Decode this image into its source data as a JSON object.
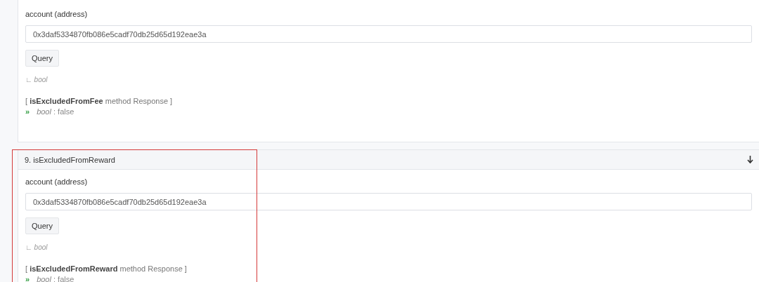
{
  "sections": [
    {
      "param_label": "account (address)",
      "value": "0x3daf5334870fb086e5cadf70db25d65d192eae3a",
      "button": "Query",
      "return_mark": "∟",
      "return_type": "bool",
      "response": {
        "open": "[",
        "method": "isExcludedFromFee",
        "rest": "method Response ]",
        "arrow": "»",
        "type": "bool",
        "colon": ":",
        "result": "false"
      }
    },
    {
      "title": "9. isExcludedFromReward",
      "highlighted": true,
      "param_label": "account (address)",
      "value": "0x3daf5334870fb086e5cadf70db25d65d192eae3a",
      "button": "Query",
      "return_mark": "∟",
      "return_type": "bool",
      "response": {
        "open": "[",
        "method": "isExcludedFromReward",
        "rest": "method Response ]",
        "arrow": "»",
        "type": "bool",
        "colon": ":",
        "result": "false"
      }
    }
  ]
}
